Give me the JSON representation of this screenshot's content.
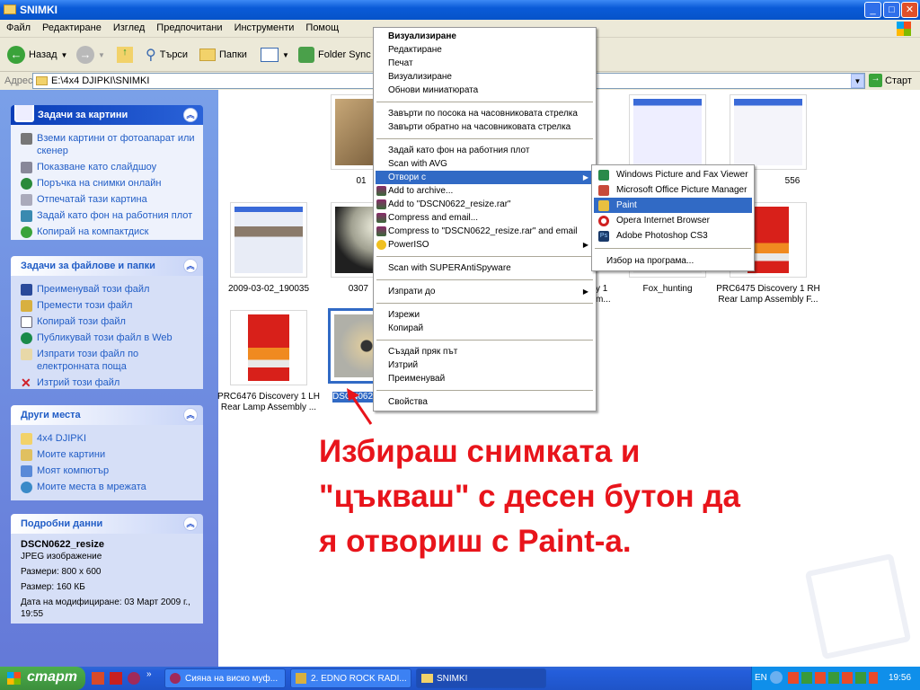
{
  "window": {
    "title": "SNIMKI"
  },
  "menubar": [
    "Файл",
    "Редактиране",
    "Изглед",
    "Предпочитани",
    "Инструменти",
    "Помощ"
  ],
  "toolbar": {
    "back": "Назад",
    "search": "Търси",
    "folders": "Папки",
    "folder_sync": "Folder Sync"
  },
  "address": {
    "label": "Адрес",
    "value": "E:\\4x4 DJIPKI\\SNIMKI",
    "go": "Старт"
  },
  "left_panel": {
    "picture_tasks": {
      "title": "Задачи за картини",
      "items": [
        "Вземи картини от фотоапарат или скенер",
        "Показване като слайдшоу",
        "Поръчка на снимки онлайн",
        "Отпечатай тази картина",
        "Задай като фон на работния плот",
        "Копирай на компактдиск"
      ]
    },
    "file_tasks": {
      "title": "Задачи за файлове и папки",
      "items": [
        "Преименувай този файл",
        "Премести този файл",
        "Копирай този файл",
        "Публикувай този файл в Web",
        "Изпрати този файл по електронната поща",
        "Изтрий този файл"
      ]
    },
    "other_places": {
      "title": "Други места",
      "items": [
        "4x4 DJIPKI",
        "Моите картини",
        "Моят компютър",
        "Моите места в мрежата"
      ]
    },
    "details": {
      "title": "Подробни данни",
      "name": "DSCN0622_resize",
      "type": "JPEG изображение",
      "dimensions": "Размери: 800 x 600",
      "size": "Размер: 160 КБ",
      "modified": "Дата на модифициране: 03 Март 2009 г., 19:55"
    }
  },
  "files": {
    "f1": "01",
    "f2": "556",
    "f3": "2009-03-02_190035",
    "f4": "0307",
    "f5a": "y 1",
    "f5b": "m...",
    "f6": "Fox_hunting",
    "f7": "PRC6475 Discovery 1 RH Rear Lamp Assembly F...",
    "f8": "PRC6476 Discovery 1 LH Rear Lamp Assembly ...",
    "f9": "DSCN0622_resize"
  },
  "context_menu": {
    "groups": [
      [
        "Визуализиране",
        "Редактиране",
        "Печат",
        "Визуализиране",
        "Обнови миниатюрата"
      ],
      [
        "Завърти по посока на часовниковата стрелка",
        "Завърти обратно на часовниковата стрелка"
      ],
      [
        "Задай като фон на работния плот",
        "Scan with AVG",
        "Отвори с",
        "Add to archive...",
        "Add to \"DSCN0622_resize.rar\"",
        "Compress and email...",
        "Compress to \"DSCN0622_resize.rar\" and email",
        "PowerISO"
      ],
      [
        "Scan with SUPERAntiSpyware"
      ],
      [
        "Изпрати до"
      ],
      [
        "Изрежи",
        "Копирай"
      ],
      [
        "Създай пряк път",
        "Изтрий",
        "Преименувай"
      ],
      [
        "Свойства"
      ]
    ]
  },
  "open_with": {
    "items": [
      "Windows Picture and Fax Viewer",
      "Microsoft Office Picture Manager",
      "Paint",
      "Opera Internet Browser",
      "Adobe Photoshop CS3"
    ],
    "choose": "Избор на програма..."
  },
  "annotation": [
    "Избираш снимката и",
    "\"цъкваш\" с десен бутон да",
    "я отвориш с Paint-а."
  ],
  "taskbar": {
    "start": "старт",
    "tasks": [
      "Сияна на виско муф...",
      "2. EDNO ROCK RADI...",
      "SNIMKI"
    ],
    "lang": "EN",
    "clock": "19:56"
  },
  "colors": {
    "highlight": "#316ac5",
    "annotation": "#e8141b"
  }
}
